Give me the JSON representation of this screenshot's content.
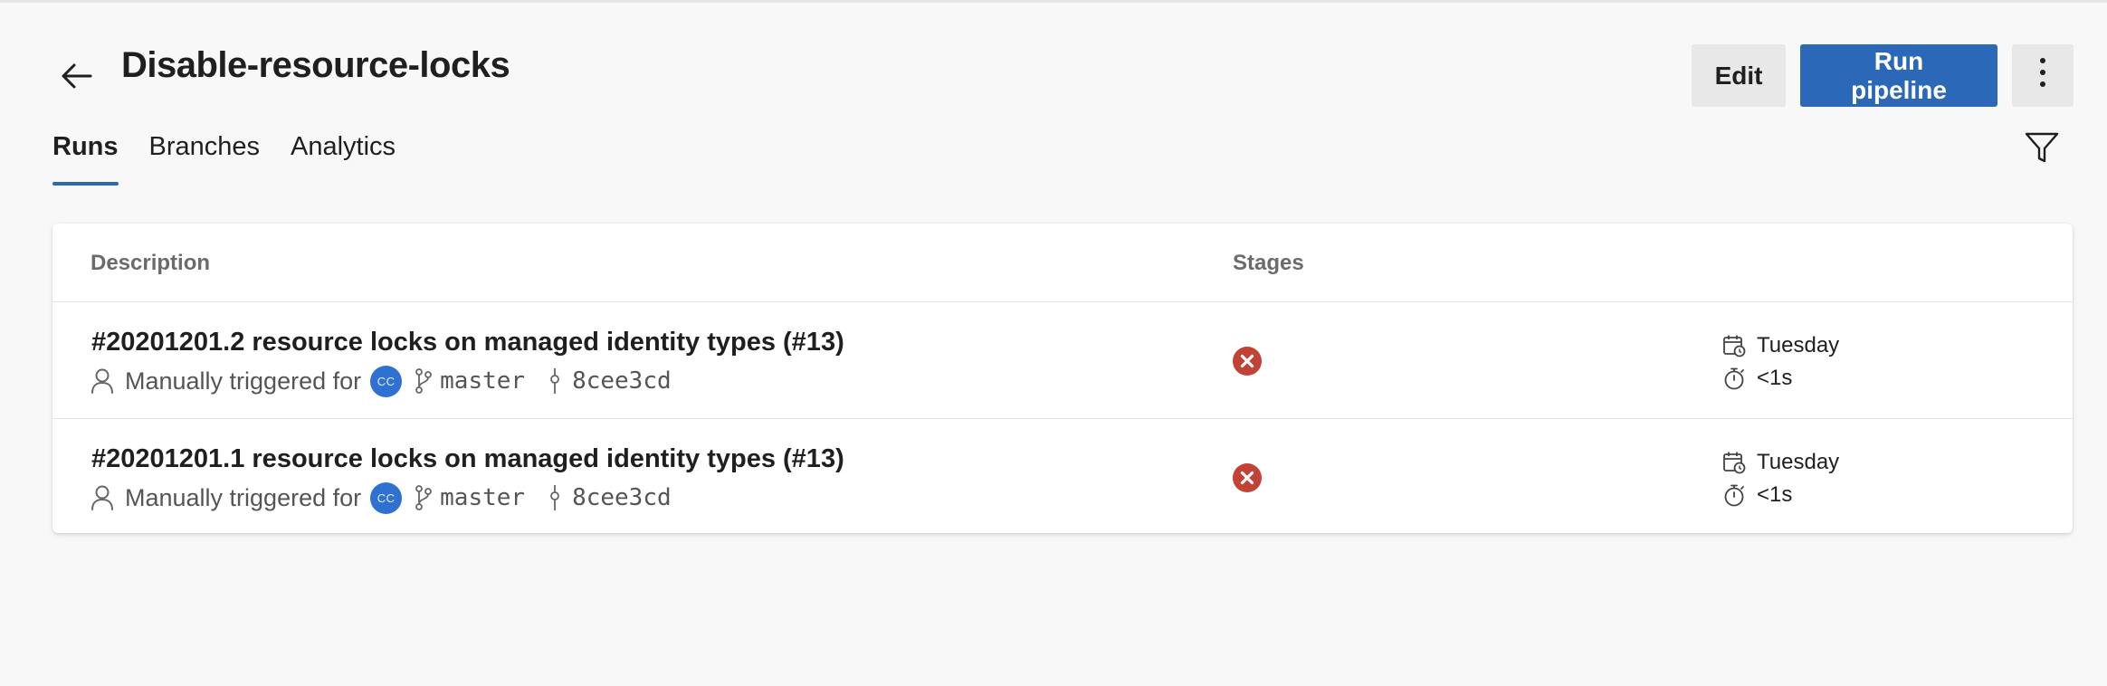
{
  "header": {
    "title": "Disable-resource-locks",
    "edit_label": "Edit",
    "run_label": "Run pipeline"
  },
  "tabs": [
    {
      "label": "Runs",
      "active": true
    },
    {
      "label": "Branches",
      "active": false
    },
    {
      "label": "Analytics",
      "active": false
    }
  ],
  "table": {
    "columns": {
      "description": "Description",
      "stages": "Stages"
    },
    "rows": [
      {
        "title": "#20201201.2 resource locks on managed identity types (#13)",
        "trigger": "Manually triggered for",
        "avatar_initials": "CC",
        "branch": "master",
        "commit": "8cee3cd",
        "stage_status": "failed",
        "date": "Tuesday",
        "duration": "<1s"
      },
      {
        "title": "#20201201.1 resource locks on managed identity types (#13)",
        "trigger": "Manually triggered for",
        "avatar_initials": "CC",
        "branch": "master",
        "commit": "8cee3cd",
        "stage_status": "failed",
        "date": "Tuesday",
        "duration": "<1s"
      }
    ]
  },
  "icons": {
    "back": "arrow-left-icon",
    "more": "more-vertical-icon",
    "filter": "filter-icon",
    "person": "person-icon",
    "branch": "branch-icon",
    "commit": "commit-icon",
    "failed": "failed-status-icon",
    "calendar": "calendar-icon",
    "timer": "stopwatch-icon"
  },
  "colors": {
    "accent": "#2b69b8",
    "failed": "#c24236",
    "avatar": "#2f71d3"
  }
}
